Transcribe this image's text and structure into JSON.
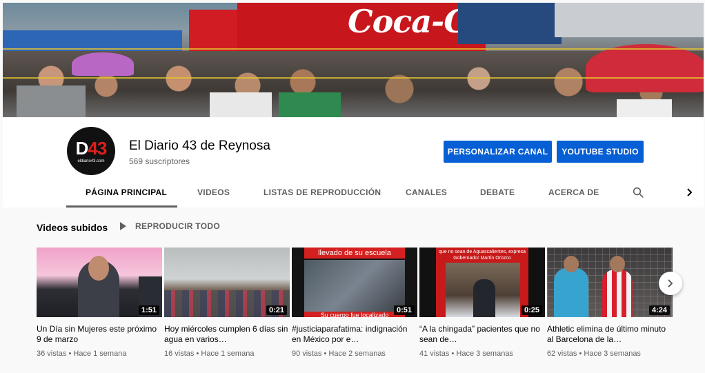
{
  "banner": {
    "brand_text": "Coca-Cola"
  },
  "channel": {
    "avatar_main_d": "D",
    "avatar_main_num": "43",
    "avatar_sub": "eldiario43.com",
    "name": "El Diario 43 de Reynosa",
    "subscribers": "569 suscriptores",
    "customize_label": "PERSONALIZAR CANAL",
    "studio_label": "YOUTUBE STUDIO",
    "accent_color": "#065fd4"
  },
  "tabs": [
    {
      "label": "PÁGINA PRINCIPAL",
      "active": true
    },
    {
      "label": "VIDEOS"
    },
    {
      "label": "LISTAS DE REPRODUCCIÓN"
    },
    {
      "label": "CANALES"
    },
    {
      "label": "DEBATE"
    },
    {
      "label": "ACERCA DE"
    }
  ],
  "icons": {
    "search": "search-icon",
    "tabs_next": "chevron-right-icon",
    "play_all": "play-icon",
    "carousel_next": "chevron-right-icon"
  },
  "section": {
    "title": "Videos subidos",
    "play_all_label": "REPRODUCIR TODO"
  },
  "videos": [
    {
      "title": "Un Día sin Mujeres este próximo 9 de marzo",
      "duration": "1:51",
      "views": "36 vistas",
      "age": "Hace 1 semana"
    },
    {
      "title": "Hoy miércoles cumplen 6 días sin agua en varios…",
      "duration": "0:21",
      "views": "16 vistas",
      "age": "Hace 1 semana"
    },
    {
      "title": "#justiciaparafatima: indignación en México por e…",
      "duration": "0:51",
      "views": "90 vistas",
      "age": "Hace 2 semanas",
      "thumb_caption_top": "llevado de su escuela",
      "thumb_caption_bottom": "Su cuerpo fue localizado"
    },
    {
      "title": "“A la chingada” pacientes que no sean de…",
      "duration": "0:25",
      "views": "41 vistas",
      "age": "Hace 3 semanas",
      "thumb_caption_top": "que no sean de Aguascalientes, expresa Gobernador Martín Orozco"
    },
    {
      "title": "Athletic elimina de último minuto al Barcelona de la…",
      "duration": "4:24",
      "views": "62 vistas",
      "age": "Hace 3 semanas"
    }
  ],
  "meta_separator": " • "
}
